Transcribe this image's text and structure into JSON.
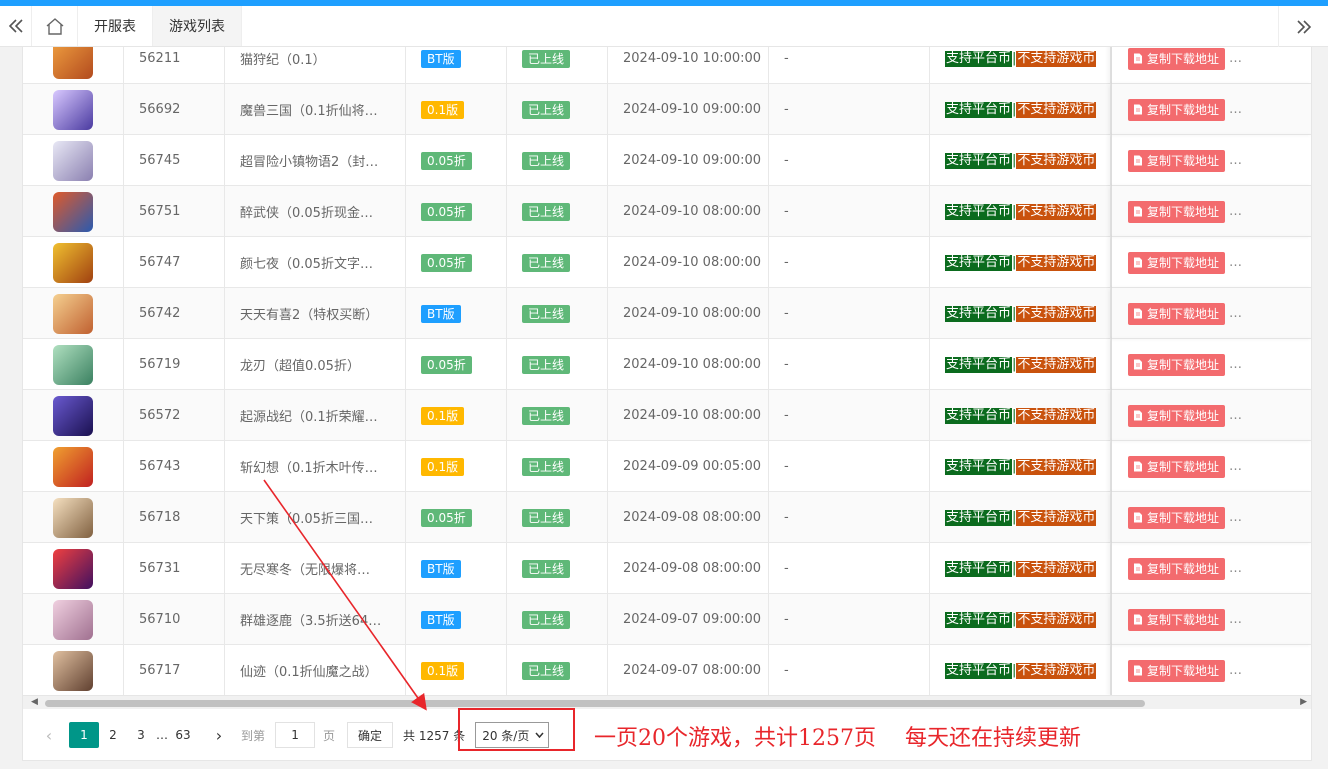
{
  "tabs": {
    "collapse_left_icon": "double-chevron-left",
    "home_icon": "home",
    "items": [
      "开服表",
      "游戏列表"
    ],
    "expand_right_icon": "double-chevron-right"
  },
  "table": {
    "status_text": "已上线",
    "date_dash": "-",
    "support_platform": "支持平台币",
    "support_game": "不支持游戏币",
    "copy_button": "复制下载地址",
    "ellipsis": "…",
    "rows": [
      {
        "id": "56211",
        "name": "猫狩纪（0.1）",
        "type": "BT版",
        "type_color": "#1e9fff",
        "date": "2024-09-10 10:00:00",
        "icon_colors": [
          "#f0a040",
          "#b24a1e"
        ]
      },
      {
        "id": "56692",
        "name": "魔兽三国（0.1折仙将…",
        "type": "0.1版",
        "type_color": "#ffb800",
        "date": "2024-09-10 09:00:00",
        "icon_colors": [
          "#d9c9ff",
          "#4a3aa0"
        ]
      },
      {
        "id": "56745",
        "name": "超冒险小镇物语2（封…",
        "type": "0.05折",
        "type_color": "#5fb878",
        "date": "2024-09-10 09:00:00",
        "icon_colors": [
          "#e8e8f5",
          "#8a7fb0"
        ]
      },
      {
        "id": "56751",
        "name": "醉武侠（0.05折现金…",
        "type": "0.05折",
        "type_color": "#5fb878",
        "date": "2024-09-10 08:00:00",
        "icon_colors": [
          "#e05a2a",
          "#2a5ab0"
        ]
      },
      {
        "id": "56747",
        "name": "颜七夜（0.05折文字…",
        "type": "0.05折",
        "type_color": "#5fb878",
        "date": "2024-09-10 08:00:00",
        "icon_colors": [
          "#f0c030",
          "#a04010"
        ]
      },
      {
        "id": "56742",
        "name": "天天有喜2（特权买断）",
        "type": "BT版",
        "type_color": "#1e9fff",
        "date": "2024-09-10 08:00:00",
        "icon_colors": [
          "#f5d090",
          "#c06030"
        ]
      },
      {
        "id": "56719",
        "name": "龙刃（超值0.05折）",
        "type": "0.05折",
        "type_color": "#5fb878",
        "date": "2024-09-10 08:00:00",
        "icon_colors": [
          "#b0e0c0",
          "#3a8060"
        ]
      },
      {
        "id": "56572",
        "name": "起源战纪（0.1折荣耀…",
        "type": "0.1版",
        "type_color": "#ffb800",
        "date": "2024-09-10 08:00:00",
        "icon_colors": [
          "#6a5ad0",
          "#1a1050"
        ]
      },
      {
        "id": "56743",
        "name": "斩幻想（0.1折木叶传…",
        "type": "0.1版",
        "type_color": "#ffb800",
        "date": "2024-09-09 00:05:00",
        "icon_colors": [
          "#f0a030",
          "#c02020"
        ]
      },
      {
        "id": "56718",
        "name": "天下策（0.05折三国…",
        "type": "0.05折",
        "type_color": "#5fb878",
        "date": "2024-09-08 08:00:00",
        "icon_colors": [
          "#f5e0c0",
          "#806040"
        ]
      },
      {
        "id": "56731",
        "name": "无尽寒冬（无限爆将…",
        "type": "BT版",
        "type_color": "#1e9fff",
        "date": "2024-09-08 08:00:00",
        "icon_colors": [
          "#f04040",
          "#401060"
        ]
      },
      {
        "id": "56710",
        "name": "群雄逐鹿（3.5折送64…",
        "type": "BT版",
        "type_color": "#1e9fff",
        "date": "2024-09-07 09:00:00",
        "icon_colors": [
          "#f0d0e0",
          "#a07090"
        ]
      },
      {
        "id": "56717",
        "name": "仙迹（0.1折仙魔之战）",
        "type": "0.1版",
        "type_color": "#ffb800",
        "date": "2024-09-07 08:00:00",
        "icon_colors": [
          "#e0c0a0",
          "#604030"
        ]
      }
    ]
  },
  "pagination": {
    "prev": "‹",
    "pages": [
      "1",
      "2",
      "3"
    ],
    "ellipsis": "…",
    "last": "63",
    "next": "›",
    "goto_label": "到第",
    "goto_value": "1",
    "page_unit": "页",
    "confirm": "确定",
    "total": "共 1257 条",
    "page_size": "20 条/页"
  },
  "annotations": {
    "note1": "一页20个游戏，共计1257页",
    "note2": "每天还在持续更新",
    "color": "#e8262b"
  }
}
